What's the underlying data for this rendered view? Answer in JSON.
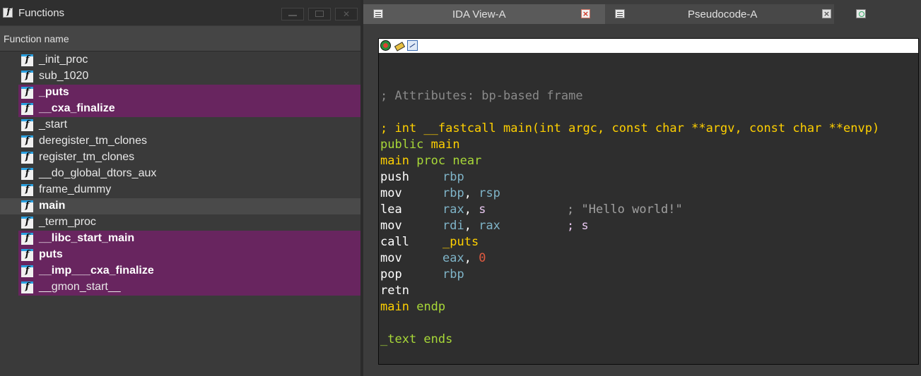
{
  "functions_panel": {
    "title": "Functions",
    "column_header": "Function name",
    "items": [
      {
        "name": "_init_proc",
        "highlighted": false,
        "bold": false,
        "selected": false
      },
      {
        "name": "sub_1020",
        "highlighted": false,
        "bold": false,
        "selected": false
      },
      {
        "name": "_puts",
        "highlighted": true,
        "bold": true,
        "selected": false
      },
      {
        "name": "__cxa_finalize",
        "highlighted": true,
        "bold": true,
        "selected": false
      },
      {
        "name": "_start",
        "highlighted": false,
        "bold": false,
        "selected": false
      },
      {
        "name": "deregister_tm_clones",
        "highlighted": false,
        "bold": false,
        "selected": false
      },
      {
        "name": "register_tm_clones",
        "highlighted": false,
        "bold": false,
        "selected": false
      },
      {
        "name": "__do_global_dtors_aux",
        "highlighted": false,
        "bold": false,
        "selected": false
      },
      {
        "name": "frame_dummy",
        "highlighted": false,
        "bold": false,
        "selected": false
      },
      {
        "name": "main",
        "highlighted": false,
        "bold": true,
        "selected": true
      },
      {
        "name": "_term_proc",
        "highlighted": false,
        "bold": false,
        "selected": false
      },
      {
        "name": "__libc_start_main",
        "highlighted": true,
        "bold": true,
        "selected": false
      },
      {
        "name": "puts",
        "highlighted": true,
        "bold": true,
        "selected": false
      },
      {
        "name": "__imp___cxa_finalize",
        "highlighted": true,
        "bold": true,
        "selected": false
      },
      {
        "name": "__gmon_start__",
        "highlighted": true,
        "bold": false,
        "selected": false
      }
    ]
  },
  "tabs": [
    {
      "label": "IDA View-A",
      "active": true
    },
    {
      "label": "Pseudocode-A",
      "active": false
    }
  ],
  "disassembly": {
    "attributes_comment": "; Attributes: bp-based frame",
    "prototype": "; int __fastcall main(int argc, const char **argv, const char **envp)",
    "public_kw": "public",
    "public_name": "main",
    "proc_name": "main",
    "proc_kw": "proc near",
    "instructions": [
      {
        "mnemonic": "push",
        "op1": "rbp",
        "sep": "",
        "op2": "",
        "comment": ""
      },
      {
        "mnemonic": "mov",
        "op1": "rbp",
        "sep": ", ",
        "op2": "rsp",
        "comment": ""
      },
      {
        "mnemonic": "lea",
        "op1": "rax",
        "sep": ", ",
        "op2": "s",
        "comment": "; \"Hello world!\""
      },
      {
        "mnemonic": "mov",
        "op1": "rdi",
        "sep": ", ",
        "op2": "rax",
        "comment": "; s"
      },
      {
        "mnemonic": "call",
        "op1": "_puts",
        "sep": "",
        "op2": "",
        "comment": ""
      },
      {
        "mnemonic": "mov",
        "op1": "eax",
        "sep": ", ",
        "op2": "0",
        "comment": ""
      },
      {
        "mnemonic": "pop",
        "op1": "rbp",
        "sep": "",
        "op2": "",
        "comment": ""
      },
      {
        "mnemonic": "retn",
        "op1": "",
        "sep": "",
        "op2": "",
        "comment": ""
      }
    ],
    "endp_name": "main",
    "endp_kw": "endp",
    "segment_end": "_text ends"
  },
  "colors": {
    "highlight_row": "#68255f",
    "prototype": "#ffd000",
    "keyword": "#a8d838",
    "register": "#7fb4c8",
    "number": "#e05a40",
    "comment": "#8a8a8a"
  }
}
